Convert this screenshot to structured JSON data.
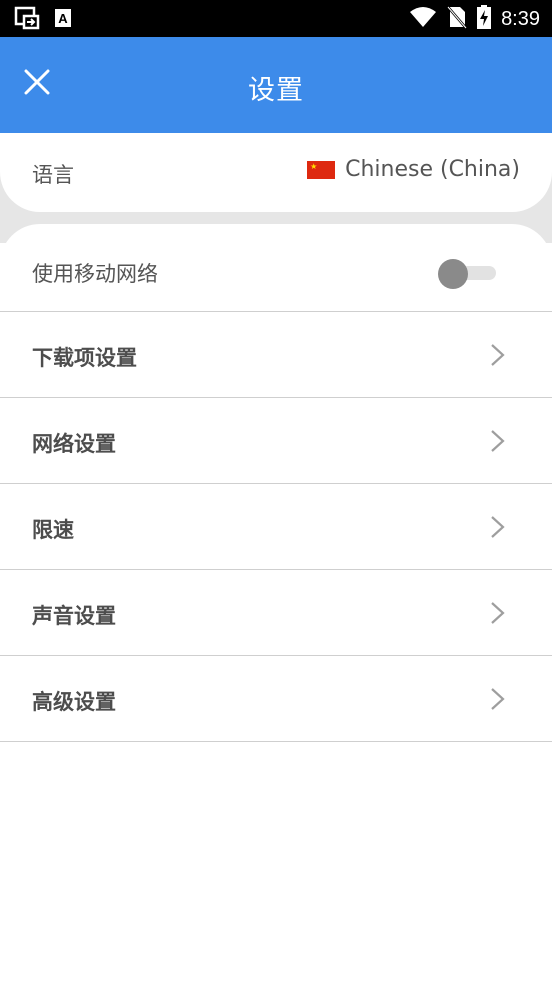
{
  "status_bar": {
    "time": "8:39",
    "left_icons": [
      "cast-icon",
      "a-notification-icon"
    ],
    "right_icons": [
      "wifi-icon",
      "no-sim-icon",
      "battery-charging-icon"
    ]
  },
  "header": {
    "title": "设置",
    "close_icon": "close-icon",
    "background": "#3d8bea"
  },
  "language": {
    "label": "语言",
    "value": "Chinese (China)",
    "flag_icon": "china-flag-icon"
  },
  "mobile_data": {
    "label": "使用移动网络",
    "enabled": false
  },
  "menu_items": [
    {
      "label": "下载项设置"
    },
    {
      "label": "网络设置"
    },
    {
      "label": "限速"
    },
    {
      "label": "声音设置"
    },
    {
      "label": "高级设置"
    }
  ]
}
